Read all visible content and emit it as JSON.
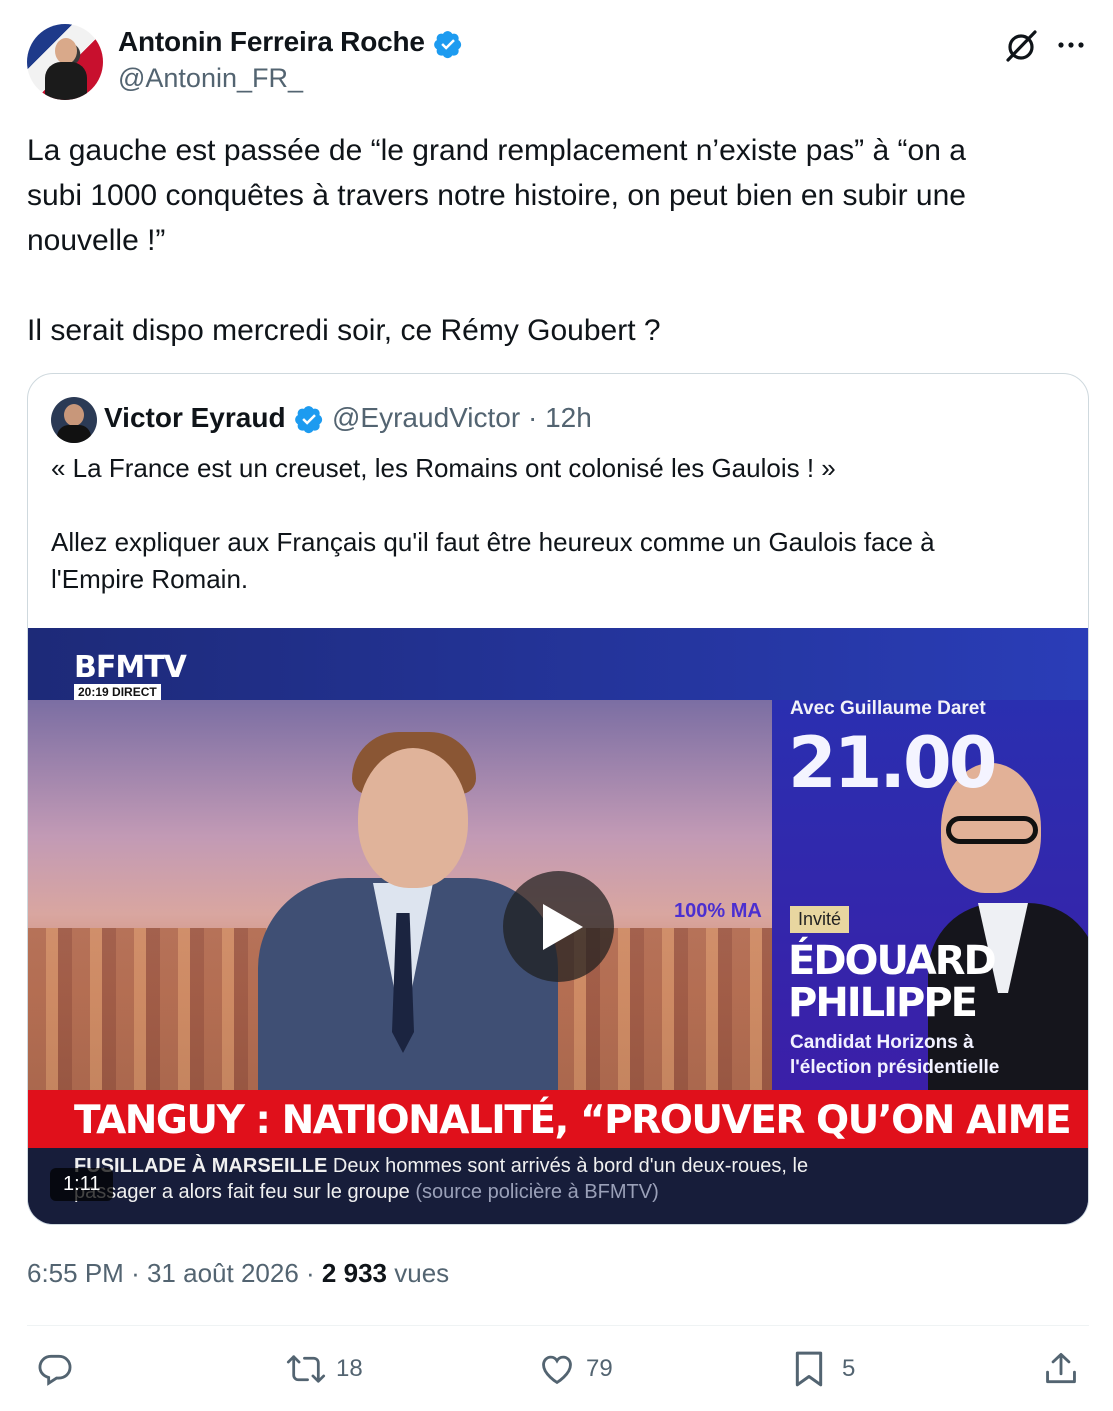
{
  "author": {
    "name": "Antonin Ferreira Roche",
    "handle": "@Antonin_FR_"
  },
  "tweet": {
    "text": "La gauche est passée de “le grand remplacement n’existe pas” à “on a\nsubi 1000 conquêtes à travers notre histoire, on peut bien en subir une\nnouvelle !”\n\nIl serait dispo mercredi soir, ce Rémy Goubert ?"
  },
  "quote": {
    "name": "Victor Eyraud",
    "handle": "@EyraudVictor",
    "sep": "·",
    "time": "12h",
    "text": "« La France est un creuset, les Romains ont colonisé les Gaulois ! »\n\nAllez expliquer aux Français qu'il faut être heureux comme un Gaulois face à\nl'Empire Romain."
  },
  "video": {
    "logo": "BFMTV",
    "time_badge": "20:19 DIRECT",
    "with_text": "Avec Guillaume Daret",
    "big_time": "21.00",
    "invite": "Invité",
    "guest_name_1": "ÉDOUARD",
    "guest_name_2": "PHILIPPE",
    "guest_role_1": "Candidat Horizons à",
    "guest_role_2": "l'élection présidentielle",
    "overlay": "100% MA",
    "headline": "TANGUY : NATIONALITÉ, “PROUVER QU’ON AIME LA FRANCE”",
    "ticker_title": "FUSILLADE À MARSEILLE",
    "ticker_line1": "Deux hommes sont arrivés à bord d'un deux-roues, le",
    "ticker_line2": "passager a alors fait feu sur le groupe",
    "ticker_source": "(source policière à BFMTV)",
    "duration": "1:11"
  },
  "meta": {
    "time": "6:55 PM",
    "sep": "·",
    "date": "31 août 2026",
    "views_count": "2 933",
    "views_label": "vues"
  },
  "actions": {
    "retweets": "18",
    "likes": "79",
    "bookmarks": "5"
  },
  "colors": {
    "accent": "#1d9bf0",
    "secondary_text": "#536471"
  }
}
